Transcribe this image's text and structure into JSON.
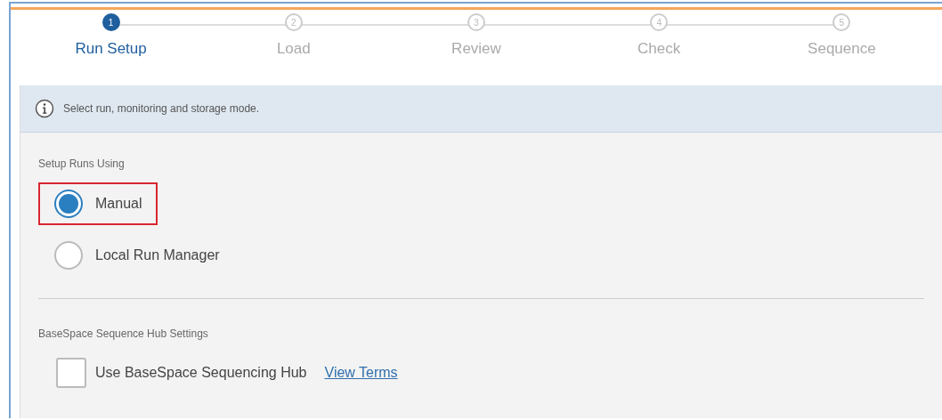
{
  "steps": [
    {
      "number": "1",
      "label": "Run Setup",
      "selected": true
    },
    {
      "number": "2",
      "label": "Load",
      "selected": false
    },
    {
      "number": "3",
      "label": "Review",
      "selected": false
    },
    {
      "number": "4",
      "label": "Check",
      "selected": false
    },
    {
      "number": "5",
      "label": "Sequence",
      "selected": false
    }
  ],
  "info": {
    "text": "Select run, monitoring and storage mode."
  },
  "setup": {
    "heading": "Setup Runs Using",
    "options": [
      {
        "label": "Manual",
        "selected": true,
        "highlighted": true
      },
      {
        "label": "Local Run Manager",
        "selected": false,
        "highlighted": false
      }
    ]
  },
  "basespace": {
    "heading": "BaseSpace Sequence Hub Settings",
    "checkbox": {
      "label": "Use BaseSpace Sequencing Hub",
      "checked": false
    },
    "link": "View Terms"
  }
}
